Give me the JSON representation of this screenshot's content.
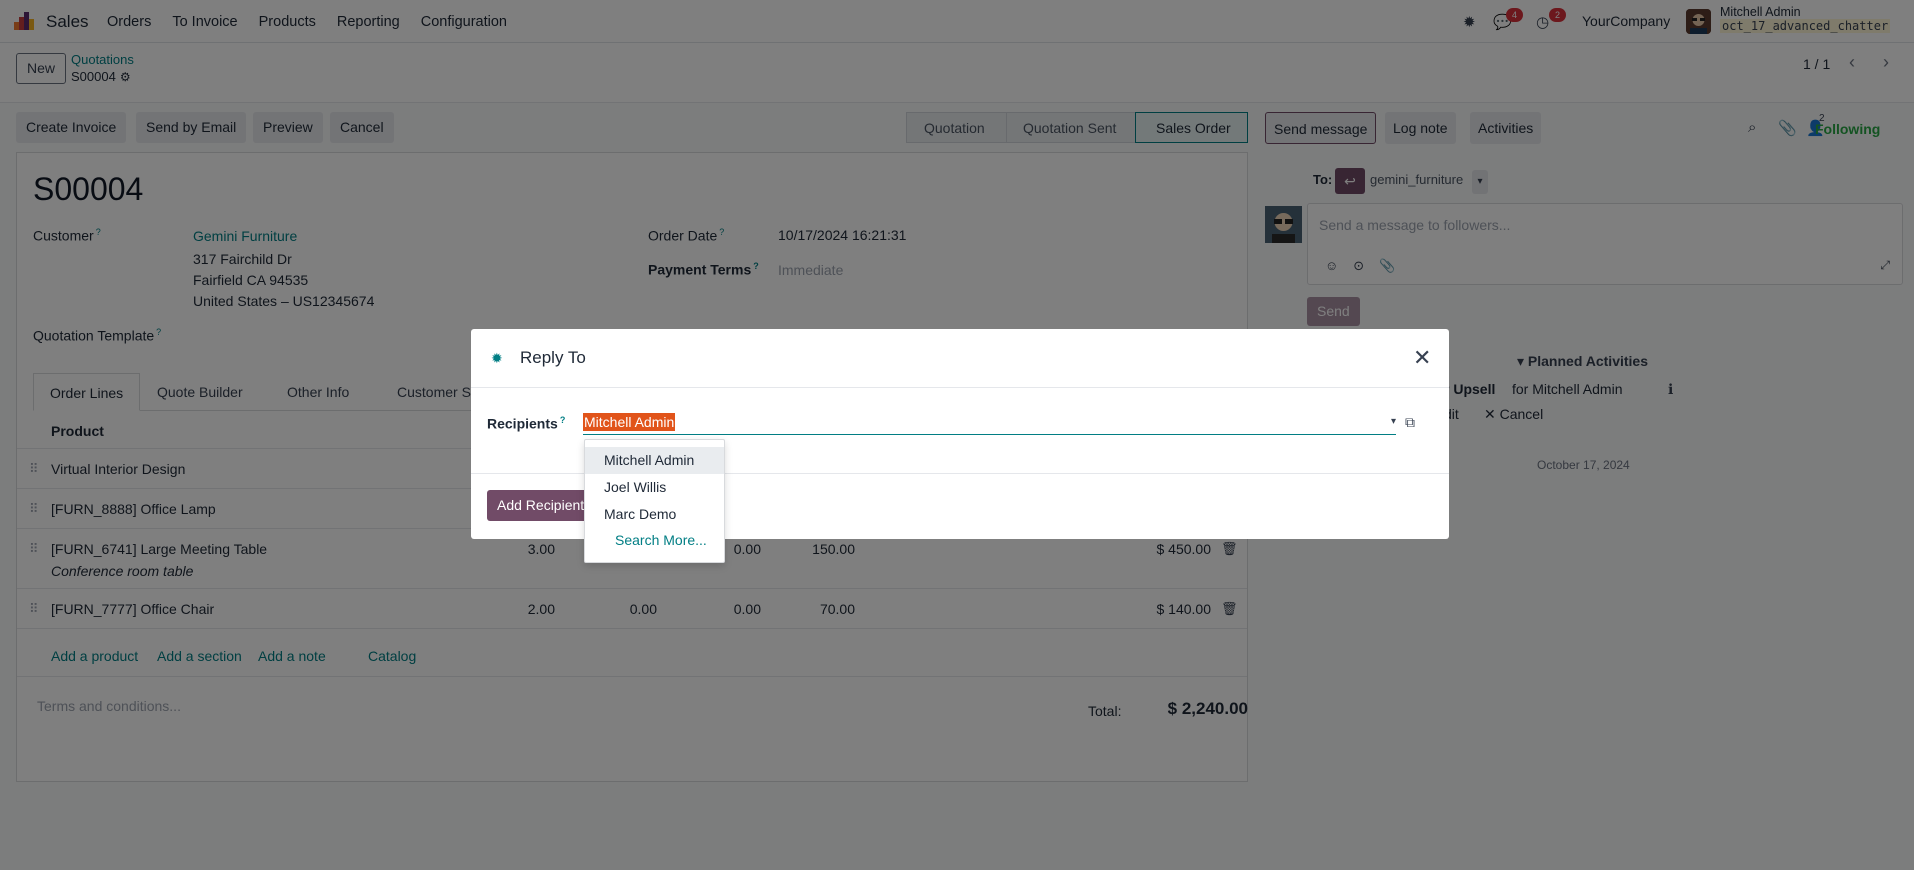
{
  "navbar": {
    "app_name": "Sales",
    "menu": [
      "Orders",
      "To Invoice",
      "Products",
      "Reporting",
      "Configuration"
    ],
    "messages_count": "4",
    "activities_count": "2",
    "company": "YourCompany",
    "user_name": "Mitchell Admin",
    "db_name": "oct_17_advanced_chatter"
  },
  "control": {
    "new_label": "New",
    "breadcrumb_parent": "Quotations",
    "breadcrumb_current": "S00004",
    "pager": "1 / 1"
  },
  "statusbar": {
    "buttons": [
      "Create Invoice",
      "Send by Email",
      "Preview",
      "Cancel"
    ],
    "stages": [
      "Quotation",
      "Quotation Sent",
      "Sales Order"
    ],
    "active_stage": "Sales Order"
  },
  "chatter_bar": {
    "send_message": "Send message",
    "log_note": "Log note",
    "activities": "Activities",
    "follower_count": "2",
    "following": "Following"
  },
  "form": {
    "name": "S00004",
    "customer_label": "Customer",
    "customer_name": "Gemini Furniture",
    "customer_address": [
      "317 Fairchild Dr",
      "Fairfield CA 94535",
      "United States – US12345674"
    ],
    "order_date_label": "Order Date",
    "order_date": "10/17/2024 16:21:31",
    "payment_terms_label": "Payment Terms",
    "payment_terms_placeholder": "Immediate",
    "template_label": "Quotation Template",
    "tabs": [
      "Order Lines",
      "Quote Builder",
      "Other Info",
      "Customer Signature"
    ],
    "product_header": "Product",
    "lines": [
      {
        "product": "Virtual Interior Design",
        "note": "",
        "qty": "",
        "c1": "",
        "c2": "",
        "price": "",
        "subtotal": ""
      },
      {
        "product": "[FURN_8888] Office Lamp",
        "note": "",
        "qty": "",
        "c1": "",
        "c2": "",
        "price": "",
        "subtotal": ""
      },
      {
        "product": "[FURN_6741] Large Meeting Table",
        "note": "Conference room table",
        "qty": "3.00",
        "c1": "",
        "c2": "0.00",
        "price": "150.00",
        "subtotal": "$ 450.00"
      },
      {
        "product": "[FURN_7777] Office Chair",
        "note": "",
        "qty": "2.00",
        "c1": "0.00",
        "c2": "0.00",
        "price": "70.00",
        "subtotal": "$ 140.00"
      }
    ],
    "add_links": [
      "Add a product",
      "Add a section",
      "Add a note",
      "Catalog"
    ],
    "terms_placeholder": "Terms and conditions...",
    "total_label": "Total:",
    "total_value": "$ 2,240.00"
  },
  "chatter": {
    "to_label": "To:",
    "to_name": "gemini_furniture",
    "composer_placeholder": "Send a message to followers...",
    "send_label": "Send",
    "planned_activities": "Planned Activities",
    "activity_title": "r Upsell",
    "activity_for": "for Mitchell Admin",
    "activity_edit": "dit",
    "activity_cancel": "Cancel",
    "date_separator": "October 17, 2024"
  },
  "modal": {
    "title": "Reply To",
    "recipients_label": "Recipients",
    "recipients_value": "Mitchell Admin",
    "add_button": "Add Recipients",
    "dropdown": [
      "Mitchell Admin",
      "Joel Willis",
      "Marc Demo"
    ],
    "search_more": "Search More..."
  },
  "colors": {
    "brand": "#714b67",
    "link": "#017e84",
    "badge": "#d9303a",
    "following": "#28a745",
    "selection": "#e1541a"
  }
}
